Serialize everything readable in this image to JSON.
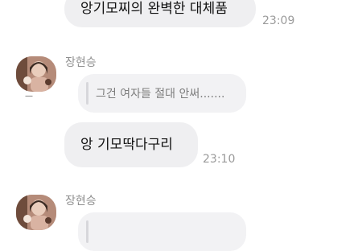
{
  "messages": [
    {
      "text": "앙기모찌의 완벽한 대체품",
      "time": "23:09"
    },
    {
      "sender": "장현승",
      "quote": "그건 여자들 절대 안써.......",
      "text": "앙 기모딱다구리",
      "time": "23:10"
    },
    {
      "sender": "장현승"
    }
  ],
  "avatar_caption": "—",
  "colors": {
    "bubble": "#efeff1",
    "time": "#9a9a9a",
    "name": "#8f8f8f"
  }
}
